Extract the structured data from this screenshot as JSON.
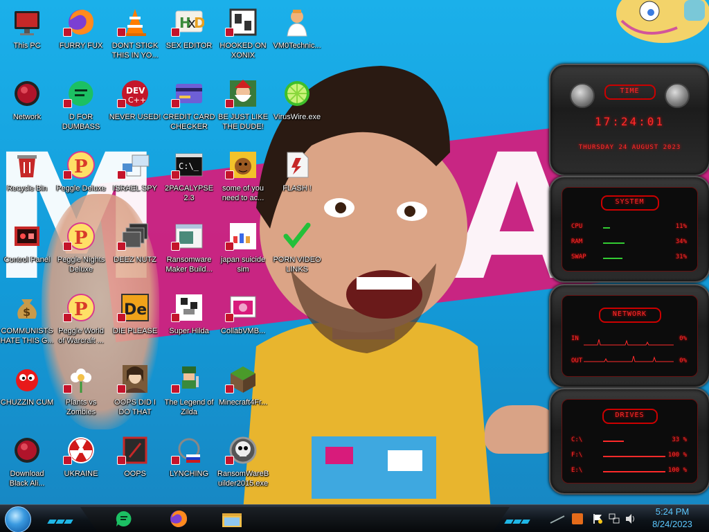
{
  "desktop": {
    "icons": [
      {
        "id": "this-pc",
        "label": "This PC",
        "icon": "computer-monitor-icon"
      },
      {
        "id": "furry-fux",
        "label": "FURRY FUX",
        "icon": "firefox-icon"
      },
      {
        "id": "dont-stick",
        "label": "DONT STICK THIS IN YO...",
        "icon": "vlc-cone-icon"
      },
      {
        "id": "sex-editor",
        "label": "SEX EDITOR",
        "icon": "hxd-editor-icon"
      },
      {
        "id": "hooked-on-xonix",
        "label": "HOOKED ON XONIX",
        "icon": "xonix-game-icon"
      },
      {
        "id": "vm0technic",
        "label": "VM0Technic...",
        "icon": "doctor-person-icon"
      },
      {
        "id": "network",
        "label": "Network",
        "icon": "red-orb-icon"
      },
      {
        "id": "d-for-dumbass",
        "label": "D FOR DUMBASS",
        "icon": "green-chat-icon"
      },
      {
        "id": "never-used",
        "label": "NEVER USED!",
        "icon": "dev-cpp-icon"
      },
      {
        "id": "credit-card-checker",
        "label": "CREDIT CARD CHECKER",
        "icon": "credit-card-icon"
      },
      {
        "id": "be-just-like",
        "label": "BE JUST LIKE THE DUDE!",
        "icon": "bearded-santa-icon"
      },
      {
        "id": "viruswire",
        "label": "VirusWire.exe",
        "icon": "lime-icon"
      },
      {
        "id": "recycle-bin",
        "label": "Recycle Bin",
        "icon": "recycle-bin-icon"
      },
      {
        "id": "peggle-deluxe",
        "label": "Peggle Deluxe",
        "icon": "peggle-icon"
      },
      {
        "id": "israel-spy",
        "label": "ISRAEL SPY",
        "icon": "network-share-icon"
      },
      {
        "id": "2pacalypse",
        "label": "2PACALYPSE 2.3",
        "icon": "terminal-icon"
      },
      {
        "id": "some-of-you",
        "label": "some of you need to ac...",
        "icon": "cartoon-dog-icon"
      },
      {
        "id": "flash",
        "label": "FLASH !",
        "icon": "flash-document-icon"
      },
      {
        "id": "control-panel",
        "label": "Control Panel",
        "icon": "control-panel-icon"
      },
      {
        "id": "peggle-nights",
        "label": "Peggle Nights Deluxe",
        "icon": "peggle-icon"
      },
      {
        "id": "deez-nutz",
        "label": "DEEZ NUTZ",
        "icon": "stacked-windows-icon"
      },
      {
        "id": "ransomware-maker",
        "label": "Ransomware Maker Build...",
        "icon": "window-app-icon"
      },
      {
        "id": "japan-suicide",
        "label": "japan suicide sim",
        "icon": "pixel-game-icon"
      },
      {
        "id": "porn-video-links",
        "label": "PORN VIDEO LINKS",
        "icon": "green-check-icon"
      },
      {
        "id": "communists",
        "label": "COMMUNISTS HATE THIS G...",
        "icon": "money-bag-icon"
      },
      {
        "id": "peggle-world",
        "label": "Peggle World of Warcraft ...",
        "icon": "peggle-icon"
      },
      {
        "id": "die-please",
        "label": "DIE PLEASE",
        "icon": "de-orange-icon"
      },
      {
        "id": "super-hilda",
        "label": "Super Hilda",
        "icon": "pixel-sprite-icon"
      },
      {
        "id": "collabvm",
        "label": "CollabVMB...",
        "icon": "pink-window-icon"
      },
      {
        "id": "chuzzin-cum",
        "label": "CHUZZIN CUM",
        "icon": "red-fuzzball-icon"
      },
      {
        "id": "plants-vs-zombies",
        "label": "Plants vs Zombies",
        "icon": "flower-icon"
      },
      {
        "id": "oops-did-i",
        "label": "OOPS DID I DO THAT",
        "icon": "portrait-woman-icon"
      },
      {
        "id": "legend-of-zilda",
        "label": "The Legend of Zilda",
        "icon": "pixel-hero-icon"
      },
      {
        "id": "minecraft",
        "label": "Minecraft4Fr...",
        "icon": "grass-block-icon"
      },
      {
        "id": "download-black-ali",
        "label": "Download Black Ali...",
        "icon": "red-orb-icon"
      },
      {
        "id": "ukraine",
        "label": "UKRAINE",
        "icon": "radiation-icon"
      },
      {
        "id": "oops",
        "label": "OOPS",
        "icon": "red-frame-icon"
      },
      {
        "id": "lynching",
        "label": "LYNCHING",
        "icon": "globe-flag-icon"
      },
      {
        "id": "ransomware-builder",
        "label": "RansomWareBuilder2015.exe",
        "icon": "skull-gear-icon"
      }
    ]
  },
  "gadgets": {
    "time": {
      "title": "TIME",
      "clock": "17:24:01",
      "date": "THURSDAY 24 AUGUST 2023"
    },
    "system": {
      "title": "SYSTEM",
      "rows": [
        {
          "label": "CPU",
          "value": "11%",
          "level": 0.11
        },
        {
          "label": "RAM",
          "value": "34%",
          "level": 0.34
        },
        {
          "label": "SWAP",
          "value": "31%",
          "level": 0.31
        }
      ]
    },
    "network": {
      "title": "NETWORK",
      "rows": [
        {
          "label": "IN",
          "value": "0%"
        },
        {
          "label": "OUT",
          "value": "0%"
        }
      ]
    },
    "drives": {
      "title": "DRIVES",
      "rows": [
        {
          "label": "C:\\",
          "value": "33 %",
          "level": 0.33
        },
        {
          "label": "F:\\",
          "value": "100 %",
          "level": 1.0
        },
        {
          "label": "E:\\",
          "value": "100 %",
          "level": 1.0
        }
      ]
    }
  },
  "taskbar": {
    "pinned": [
      {
        "id": "chat",
        "icon": "green-chat-icon"
      },
      {
        "id": "firefox",
        "icon": "firefox-icon"
      },
      {
        "id": "explorer",
        "icon": "folder-icon"
      }
    ],
    "clock_time": "5:24 PM",
    "clock_date": "8/24/2023"
  },
  "colors": {
    "gadget_red": "#ff2a2a",
    "clock_text": "#5cc8ff",
    "wallpaper_blue": "#1aa3e0",
    "wallpaper_pink": "#d81b7b"
  }
}
